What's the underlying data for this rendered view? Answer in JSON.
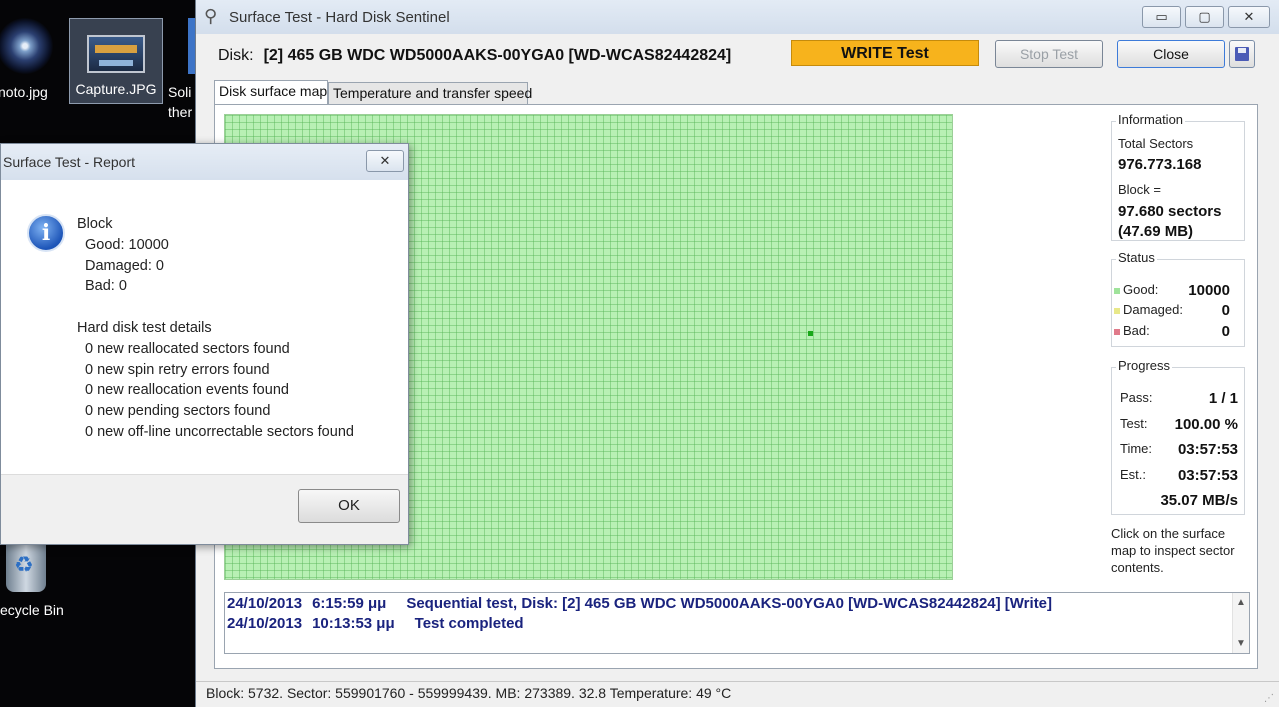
{
  "desktop": {
    "icons": [
      {
        "label": "noto.jpg"
      },
      {
        "label": "Capture.JPG"
      },
      {
        "label": "Soli",
        "label2": "ther"
      },
      {
        "label": "ecycle Bin"
      }
    ]
  },
  "window": {
    "title": "Surface Test - Hard Disk Sentinel",
    "buttons": {
      "minimize": "▭",
      "maximize": "▢",
      "close": "✕"
    }
  },
  "toolbar": {
    "disk_prefix": "Disk:",
    "disk_name": "[2] 465 GB  WDC WD5000AAKS-00YGA0 [WD-WCAS82442824]",
    "write_test_label": "WRITE Test",
    "stop_test_label": "Stop Test",
    "close_label": "Close"
  },
  "tabs": [
    {
      "label": "Disk surface map",
      "active": true
    },
    {
      "label": "Temperature and transfer speed",
      "active": false
    }
  ],
  "information": {
    "title": "Information",
    "total_sectors_label": "Total Sectors",
    "total_sectors_value": "976.773.168",
    "block_label": "Block =",
    "block_value": "97.680 sectors",
    "block_size": "(47.69 MB)"
  },
  "status": {
    "title": "Status",
    "good_label": "Good:",
    "good_value": "10000",
    "damaged_label": "Damaged:",
    "damaged_value": "0",
    "bad_label": "Bad:",
    "bad_value": "0",
    "colors": {
      "good": "#9fe39b",
      "damaged": "#e8e88a",
      "bad": "#e07a8a"
    }
  },
  "progress": {
    "title": "Progress",
    "pass_label": "Pass:",
    "pass_value": "1 / 1",
    "test_label": "Test:",
    "test_value": "100.00 %",
    "time_label": "Time:",
    "time_value": "03:57:53",
    "est_label": "Est.:",
    "est_value": "03:57:53",
    "speed_value": "35.07 MB/s"
  },
  "hint": "Click on the surface map to inspect sector contents.",
  "log": [
    {
      "date": "24/10/2013",
      "time": "6:15:59 μμ",
      "message": "Sequential test, Disk: [2] 465 GB  WDC WD5000AAKS-00YGA0 [WD-WCAS82442824] [Write]"
    },
    {
      "date": "24/10/2013",
      "time": "10:13:53 μμ",
      "message": "Test completed"
    }
  ],
  "statusbar": "Block: 5732. Sector: 559901760 - 559999439. MB: 273389. 32.8 Temperature: 49  °C",
  "dialog": {
    "title": "Surface Test - Report",
    "close_glyph": "✕",
    "icon": "i",
    "block_heading": "Block",
    "good": "Good: 10000",
    "damaged": "Damaged: 0",
    "bad": "Bad: 0",
    "details_heading": "Hard disk test details",
    "details": [
      "0 new reallocated sectors found",
      "0 new spin retry errors found",
      "0 new reallocation events found",
      "0 new pending sectors found",
      "0 new off-line uncorrectable sectors found"
    ],
    "ok_label": "OK"
  }
}
